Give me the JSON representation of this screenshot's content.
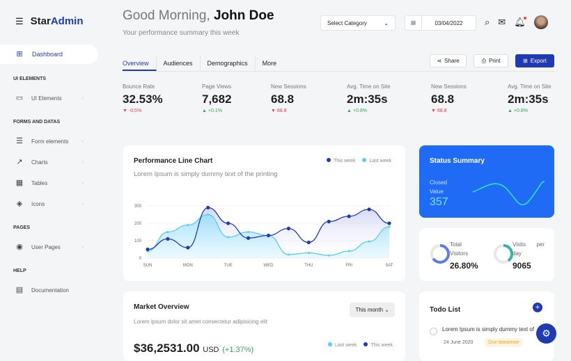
{
  "brand": {
    "part1": "Star",
    "part2": "Admin"
  },
  "sidebar": {
    "active": "Dashboard",
    "sections": [
      "UI ELEMENTS",
      "FORMS AND DATAS",
      "PAGES",
      "HELP"
    ],
    "items": [
      {
        "label": "UI Elements",
        "icon": "monitor-icon"
      },
      {
        "label": "Form elements",
        "icon": "list-icon"
      },
      {
        "label": "Charts",
        "icon": "chart-icon"
      },
      {
        "label": "Tables",
        "icon": "table-icon"
      },
      {
        "label": "Icons",
        "icon": "layers-icon"
      },
      {
        "label": "User Pages",
        "icon": "user-icon"
      },
      {
        "label": "Documentation",
        "icon": "document-icon"
      }
    ]
  },
  "header": {
    "greeting": "Good Morning,",
    "name": "John Doe",
    "subtitle": "Your performance summary this week",
    "category": "Select Category",
    "date": "03/04/2022"
  },
  "tabs": [
    "Overview",
    "Audiences",
    "Demographics",
    "More"
  ],
  "actions": {
    "share": "Share",
    "print": "Print",
    "export": "Export"
  },
  "stats": [
    {
      "label": "Bounce Rate",
      "value": "32.53%",
      "delta": "-0.5%",
      "dir": "down"
    },
    {
      "label": "Page Views",
      "value": "7,682",
      "delta": "+0.1%",
      "dir": "up"
    },
    {
      "label": "New Sessions",
      "value": "68.8",
      "delta": "68.8",
      "dir": "down"
    },
    {
      "label": "Avg. Time on Site",
      "value": "2m:35s",
      "delta": "+0.8%",
      "dir": "up"
    },
    {
      "label": "New Sessions",
      "value": "68.8",
      "delta": "68.8",
      "dir": "down"
    },
    {
      "label": "Avg. Time on Site",
      "value": "2m:35s",
      "delta": "+0.8%",
      "dir": "up"
    }
  ],
  "performance": {
    "title": "Performance Line Chart",
    "subtitle": "Lorem Ipsum is simply dummy text of the printing"
  },
  "chart_data": {
    "type": "area",
    "x": [
      "SUN",
      "",
      "MON",
      "",
      "TUE",
      "",
      "WED",
      "",
      "THU",
      "",
      "FRI",
      "",
      "SAT"
    ],
    "xticks": [
      "SUN",
      "MON",
      "TUE",
      "WED",
      "THU",
      "FRI",
      "SAT"
    ],
    "yticks": [
      0,
      100,
      200,
      300
    ],
    "ylim": [
      0,
      300
    ],
    "grid": true,
    "legend": "top-right",
    "series": [
      {
        "name": "This week",
        "color": "#1f3bb3",
        "values": [
          50,
          110,
          60,
          290,
          200,
          115,
          130,
          170,
          90,
          210,
          240,
          280,
          200
        ]
      },
      {
        "name": "Last week",
        "color": "#52cdff",
        "values": [
          40,
          150,
          190,
          250,
          120,
          150,
          130,
          20,
          30,
          15,
          40,
          95,
          180
        ]
      }
    ]
  },
  "status": {
    "title": "Status Summary",
    "label1": "Closed",
    "label2": "Value",
    "value": "357"
  },
  "visitors": {
    "total_l1": "Total",
    "total_l2": "Visitors",
    "total": "26.80%",
    "total_pct": 0.65,
    "visits_l1": "Visits",
    "visits_per": "per",
    "visits_l2": "day",
    "visits": "9065",
    "visits_pct": 0.4
  },
  "market": {
    "title": "Market Overview",
    "subtitle": "Lorem ipsum dolor sit amet consectetur adipisicing elit",
    "filter": "This month",
    "value": "$36,2531.00",
    "currency": "USD",
    "change": "(+1.37%)",
    "legend": [
      "Last week",
      "This week"
    ]
  },
  "todo": {
    "title": "Todo List",
    "text": "Lorem Ipsum is simply dummy text of",
    "date": "24 June 2020",
    "badge": "Due tomorrow"
  }
}
